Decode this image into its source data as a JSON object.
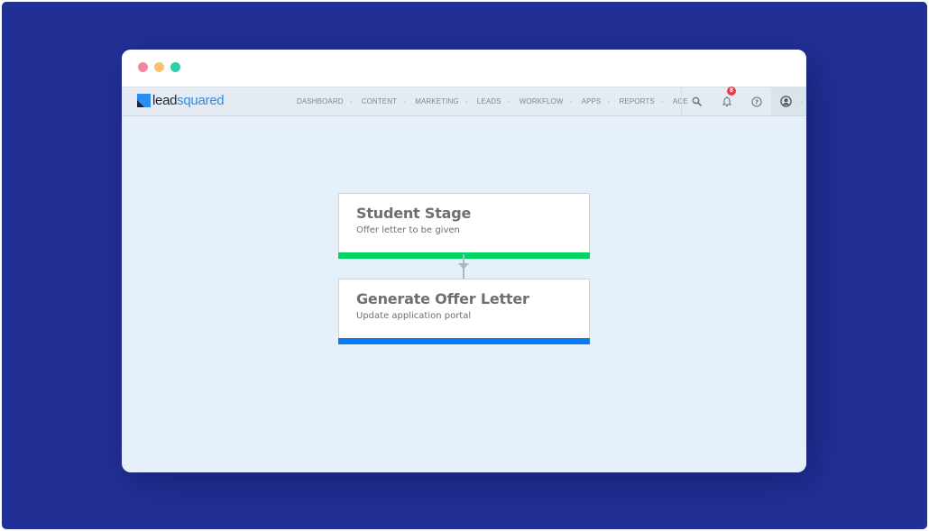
{
  "window": {
    "controls": [
      "close",
      "minimize",
      "maximize"
    ]
  },
  "navbar": {
    "logo": {
      "part1": "lead",
      "part2": "squared"
    },
    "menu": [
      {
        "label": "DASHBOARD"
      },
      {
        "label": "CONTENT"
      },
      {
        "label": "MARKETING"
      },
      {
        "label": "LEADS"
      },
      {
        "label": "WORKFLOW"
      },
      {
        "label": "APPS"
      },
      {
        "label": "REPORTS"
      },
      {
        "label": "ACE"
      }
    ],
    "icons": {
      "search": "search-icon",
      "notifications": "bell-icon",
      "help": "help-icon",
      "user": "user-icon"
    },
    "notification_count": "8"
  },
  "workflow": {
    "cards": [
      {
        "title": "Student Stage",
        "subtitle": "Offer letter to be given",
        "accent": "#00d563"
      },
      {
        "title": "Generate Offer Letter",
        "subtitle": "Update application portal",
        "accent": "#0a7cf3"
      }
    ]
  },
  "colors": {
    "backdrop": "#223096",
    "canvas": "#e6f0f8",
    "brand_blue": "#2d8cf0"
  }
}
